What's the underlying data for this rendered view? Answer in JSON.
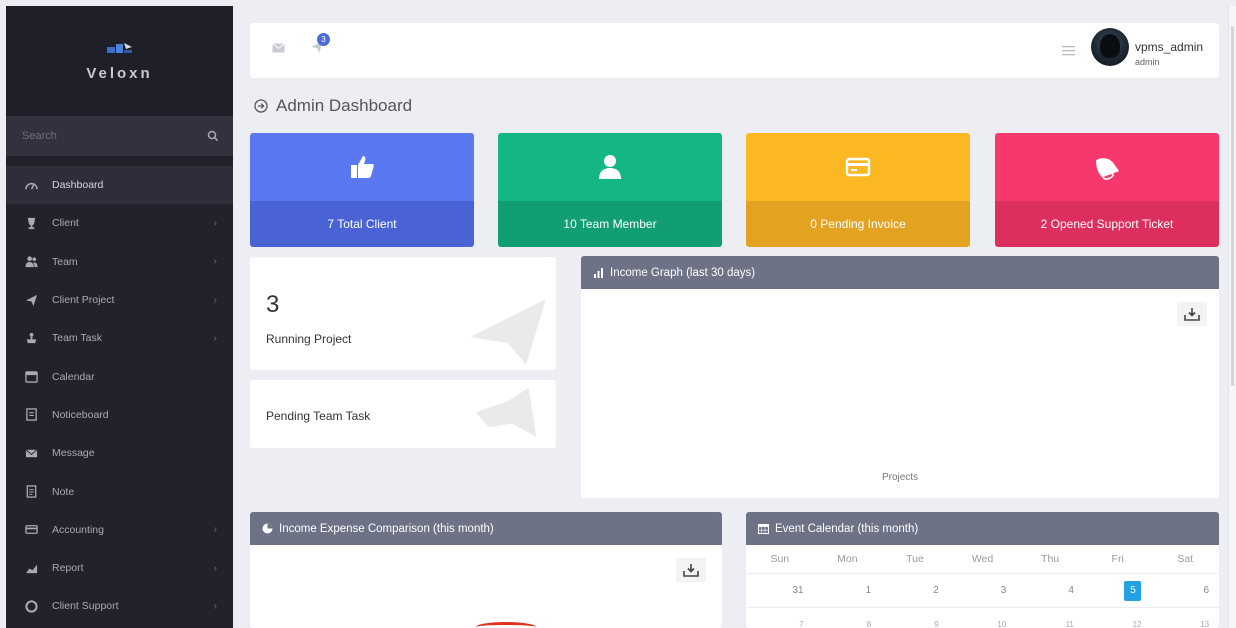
{
  "sidebar": {
    "brand": "Veloxn",
    "search_placeholder": "Search",
    "items": [
      {
        "label": "Dashboard",
        "icon": "dashboard-icon",
        "active": true,
        "has_children": false
      },
      {
        "label": "Client",
        "icon": "trophy-icon",
        "active": false,
        "has_children": true
      },
      {
        "label": "Team",
        "icon": "team-icon",
        "active": false,
        "has_children": true
      },
      {
        "label": "Client Project",
        "icon": "paper-plane-icon",
        "active": false,
        "has_children": true
      },
      {
        "label": "Team Task",
        "icon": "tasks-icon",
        "active": false,
        "has_children": true
      },
      {
        "label": "Calendar",
        "icon": "calendar-icon",
        "active": false,
        "has_children": false
      },
      {
        "label": "Noticeboard",
        "icon": "noticeboard-icon",
        "active": false,
        "has_children": false
      },
      {
        "label": "Message",
        "icon": "envelope-icon",
        "active": false,
        "has_children": false
      },
      {
        "label": "Note",
        "icon": "note-icon",
        "active": false,
        "has_children": false
      },
      {
        "label": "Accounting",
        "icon": "credit-card-icon",
        "active": false,
        "has_children": true
      },
      {
        "label": "Report",
        "icon": "area-chart-icon",
        "active": false,
        "has_children": true
      },
      {
        "label": "Client Support",
        "icon": "life-ring-icon",
        "active": false,
        "has_children": true
      }
    ]
  },
  "topbar": {
    "notification_count": "3",
    "user_name": "vpms_admin",
    "user_role": "admin"
  },
  "page": {
    "title": "Admin Dashboard"
  },
  "stats": [
    {
      "label": "7 Total Client",
      "icon": "thumbs-up-icon",
      "color": "#5a78f0"
    },
    {
      "label": "10 Team Member",
      "icon": "user-icon",
      "color": "#14b686"
    },
    {
      "label": "0 Pending Invoice",
      "icon": "credit-card-icon",
      "color": "#fbb823"
    },
    {
      "label": "2 Opened Support Ticket",
      "icon": "bell-icon",
      "color": "#f6386c"
    }
  ],
  "running_project": {
    "count": "3",
    "label": "Running Project"
  },
  "pending_task": {
    "label": "Pending Team Task"
  },
  "income_graph": {
    "title": "Income Graph (last 30 days)",
    "caption": "Projects"
  },
  "expense": {
    "title": "Income Expense Comparison (this month)"
  },
  "calendar": {
    "title": "Event Calendar (this month)",
    "weekdays": [
      "Sun",
      "Mon",
      "Tue",
      "Wed",
      "Thu",
      "Fri",
      "Sat"
    ],
    "week1": [
      "31",
      "1",
      "2",
      "3",
      "4",
      "5",
      "6"
    ],
    "week2": [
      "7",
      "8",
      "9",
      "10",
      "11",
      "12",
      "13"
    ],
    "today": "5"
  }
}
